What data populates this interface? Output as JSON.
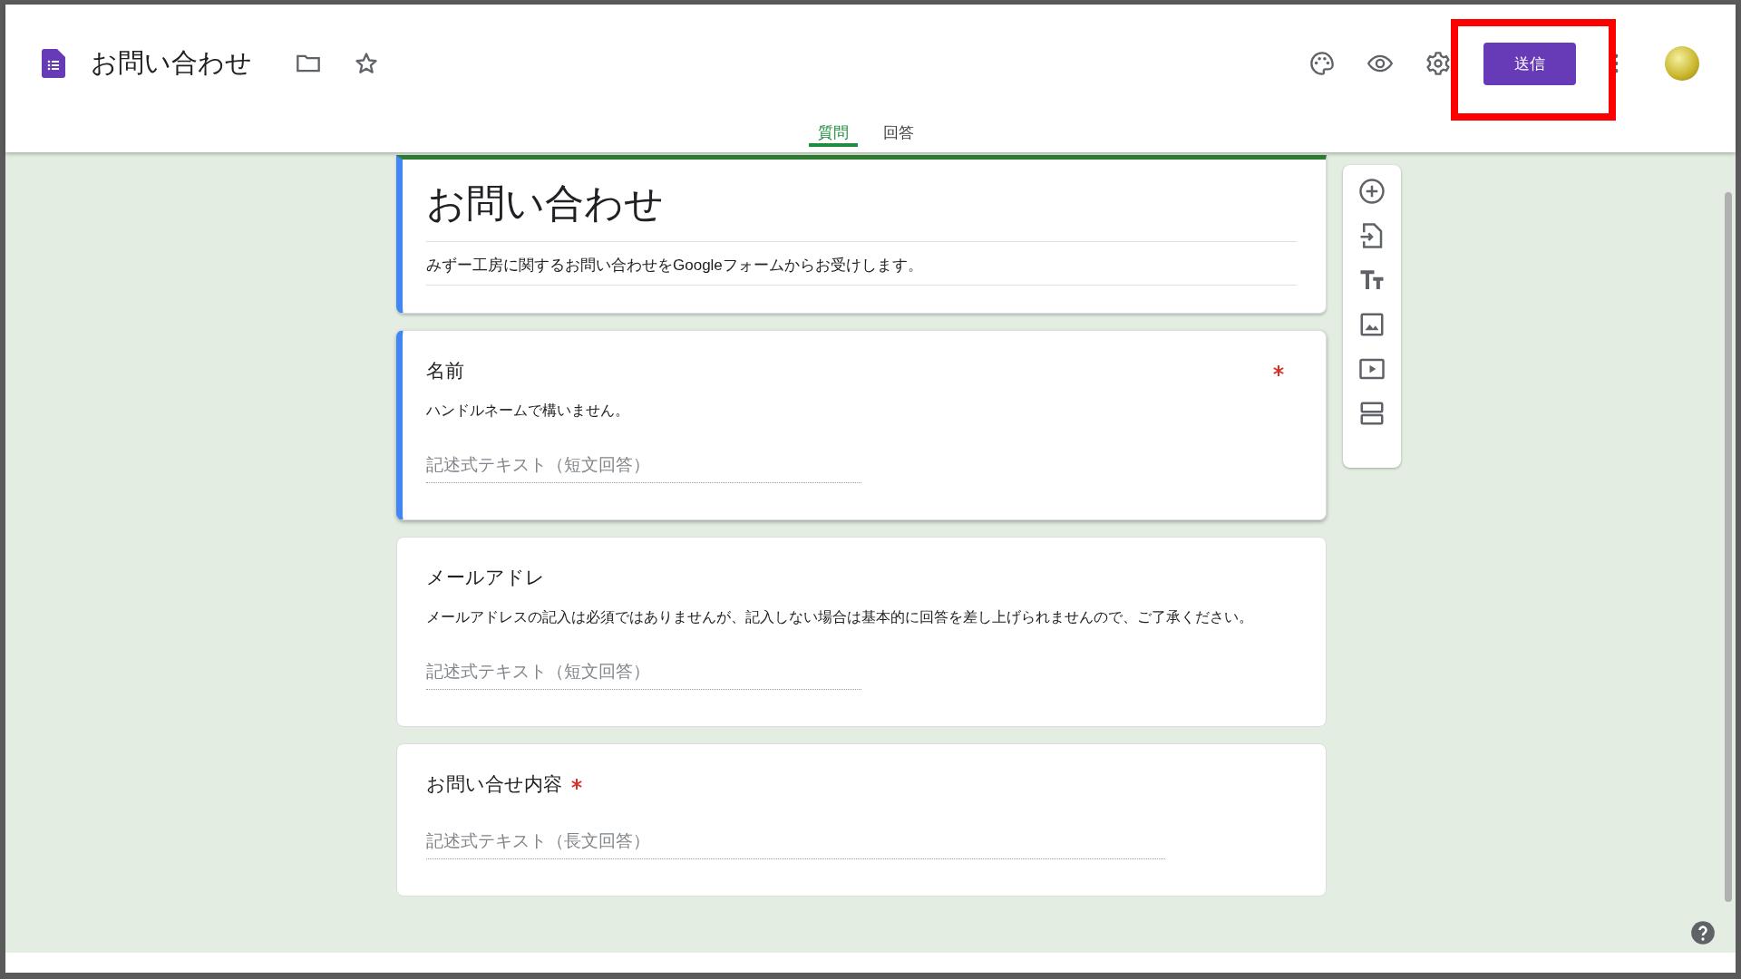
{
  "header": {
    "title": "お問い合わせ",
    "send_button": "送信"
  },
  "tabs": [
    {
      "label": "質問",
      "selected": true
    },
    {
      "label": "回答",
      "selected": false
    }
  ],
  "form": {
    "title": "お問い合わせ",
    "description": "みずー工房に関するお問い合わせをGoogleフォームからお受けします。",
    "selected": true
  },
  "questions": [
    {
      "title": "名前",
      "help": "ハンドルネームで構いません。",
      "required": true,
      "selected": true,
      "kind": "short",
      "placeholder": "記述式テキスト（短文回答）"
    },
    {
      "title": "メールアドレ",
      "help": "メールアドレスの記入は必須ではありませんが、記入しない場合は基本的に回答を差し上げられませんので、ご了承ください。",
      "required": false,
      "selected": false,
      "kind": "short",
      "placeholder": "記述式テキスト（短文回答）"
    },
    {
      "title": "お問い合せ内容",
      "required": true,
      "selected": false,
      "kind": "paragraph",
      "placeholder": "記述式テキスト（長文回答）"
    }
  ]
}
